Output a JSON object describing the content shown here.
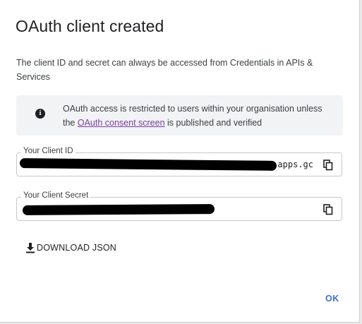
{
  "dialog": {
    "title": "OAuth client created",
    "description": "The client ID and secret can always be accessed from Credentials in APIs & Services",
    "info": {
      "icon": "info-icon",
      "text_before": "OAuth access is restricted to users within your organisation unless the ",
      "link": "OAuth consent screen",
      "text_after": " is published and verified"
    },
    "client_id": {
      "label": "Your Client ID",
      "value_visible": "p7r92.apps.gc",
      "copy_icon": "copy-icon"
    },
    "client_secret": {
      "label": "Your Client Secret",
      "value_visible": "",
      "copy_icon": "copy-icon"
    },
    "download_label": "DOWNLOAD JSON",
    "download_icon": "download-icon",
    "ok_label": "OK",
    "colors": {
      "link": "#7b3fa0",
      "accent": "#3b6fd0",
      "info_bg": "#f1f3f4",
      "redaction": "#000000"
    }
  }
}
